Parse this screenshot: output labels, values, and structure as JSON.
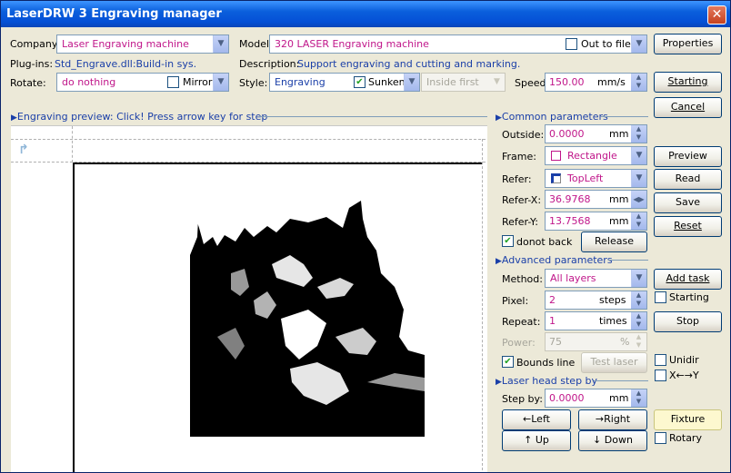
{
  "title": "LaserDRW 3 Engraving manager",
  "top": {
    "company_label": "Company:",
    "company_value": "Laser Engraving machine",
    "plugins_label": "Plug-ins:",
    "plugins_value": "Std_Engrave.dll:Build-in sys.",
    "rotate_label": "Rotate:",
    "rotate_value": "do nothing",
    "mirror_label": "Mirror",
    "model_label": "Model:",
    "model_value": "320 LASER Engraving machine",
    "out_to_file_label": "Out to file",
    "description_label": "Description:",
    "description_value": "Support engraving and cutting and marking.",
    "style_label": "Style:",
    "style_value": "Engraving",
    "sunken_label": "Sunken",
    "inside_first_value": "Inside first",
    "speed_label": "Speed:",
    "speed_value": "150.00",
    "speed_unit": "mm/s"
  },
  "right_buttons": {
    "properties": "Properties",
    "starting": "Starting",
    "cancel": "Cancel",
    "preview": "Preview",
    "read": "Read",
    "save": "Save",
    "reset": "Reset",
    "add_task": "Add task",
    "starting_check": "Starting",
    "stop": "Stop",
    "unidir": "Unidir",
    "xy": "X←→Y",
    "fixture": "Fixture",
    "rotary": "Rotary"
  },
  "preview": {
    "header": "Engraving preview: Click! Press arrow key for step"
  },
  "common": {
    "header": "Common parameters",
    "outside_label": "Outside:",
    "outside_value": "0.0000",
    "outside_unit": "mm",
    "frame_label": "Frame:",
    "frame_value": "Rectangle",
    "refer_label": "Refer:",
    "refer_value": "TopLeft",
    "refer_x_label": "Refer-X:",
    "refer_x_value": "36.9768",
    "refer_x_unit": "mm",
    "refer_y_label": "Refer-Y:",
    "refer_y_value": "13.7568",
    "refer_y_unit": "mm",
    "donot_back_label": "donot back",
    "release": "Release"
  },
  "advanced": {
    "header": "Advanced parameters",
    "method_label": "Method:",
    "method_value": "All layers",
    "pixel_label": "Pixel:",
    "pixel_value": "2",
    "pixel_unit": "steps",
    "repeat_label": "Repeat:",
    "repeat_value": "1",
    "repeat_unit": "times",
    "power_label": "Power:",
    "power_value": "75",
    "power_unit": "%",
    "bounds_line_label": "Bounds line",
    "test_laser": "Test laser"
  },
  "step": {
    "header": "Laser head step by",
    "step_by_label": "Step by:",
    "step_by_value": "0.0000",
    "step_by_unit": "mm",
    "left": "←Left",
    "right": "→Right",
    "up": "↑ Up",
    "down": "↓ Down"
  },
  "colors": {
    "title_bar": "#0a5fdc",
    "label_blue": "#1a3fa8",
    "value_magenta": "#c0168a",
    "window_bg": "#ece9d8"
  }
}
